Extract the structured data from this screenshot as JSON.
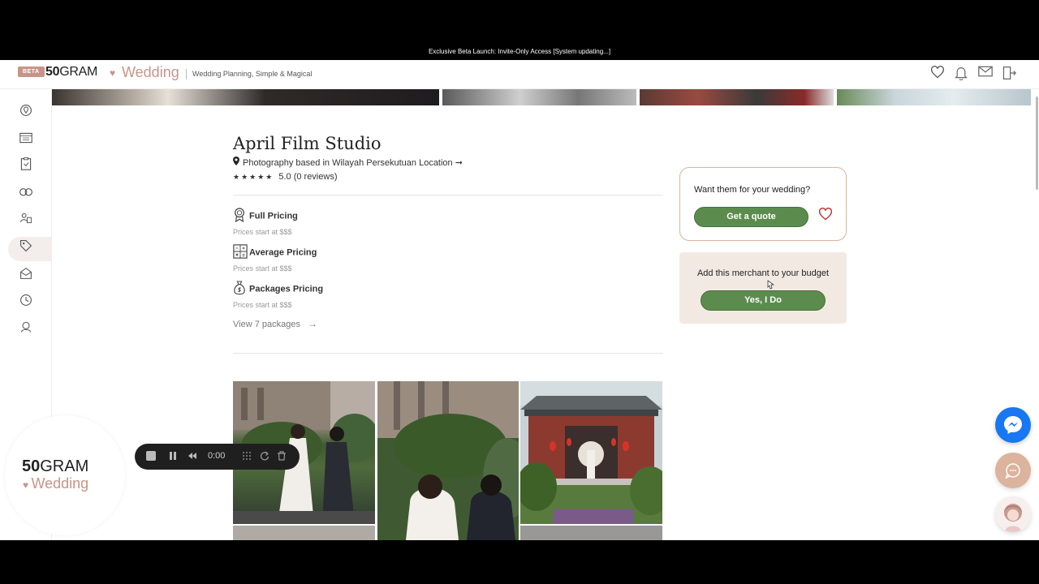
{
  "banner": {
    "text": "Exclusive Beta Launch: Invite-Only Access [System updating...]"
  },
  "header": {
    "beta": "BETA",
    "brand_num": "50",
    "brand_gram": "GRAM",
    "brand_wedding": "Wedding",
    "tagline": "Wedding Planning, Simple & Magical"
  },
  "sidebar_logo": {
    "num": "50",
    "gram": "GRAM",
    "wedding": "Wedding"
  },
  "merchant": {
    "name": "April Film Studio",
    "location": "Photography based in Wilayah Persekutuan Location ➞",
    "stars": "★★★★★",
    "rating": "5.0 (0 reviews)"
  },
  "pricing": [
    {
      "icon": "award-icon",
      "title": "Full Pricing",
      "subtitle": "Prices start at $$$"
    },
    {
      "icon": "calculator-icon",
      "title": "Average Pricing",
      "subtitle": "Prices start at $$$"
    },
    {
      "icon": "money-bag-icon",
      "title": "Packages Pricing",
      "subtitle": "Prices start at $$$"
    }
  ],
  "view_packages": "View 7 packages",
  "quote_card": {
    "question": "Want them for your wedding?",
    "button": "Get a quote"
  },
  "budget_card": {
    "question": "Add this merchant to your budget",
    "button": "Yes, I Do"
  },
  "recorder": {
    "time": "0:00"
  },
  "colors": {
    "accent": "#c8948a",
    "green": "#5b8c4e",
    "card_border": "#d9b49d",
    "budget_bg": "#f3e9e3"
  }
}
